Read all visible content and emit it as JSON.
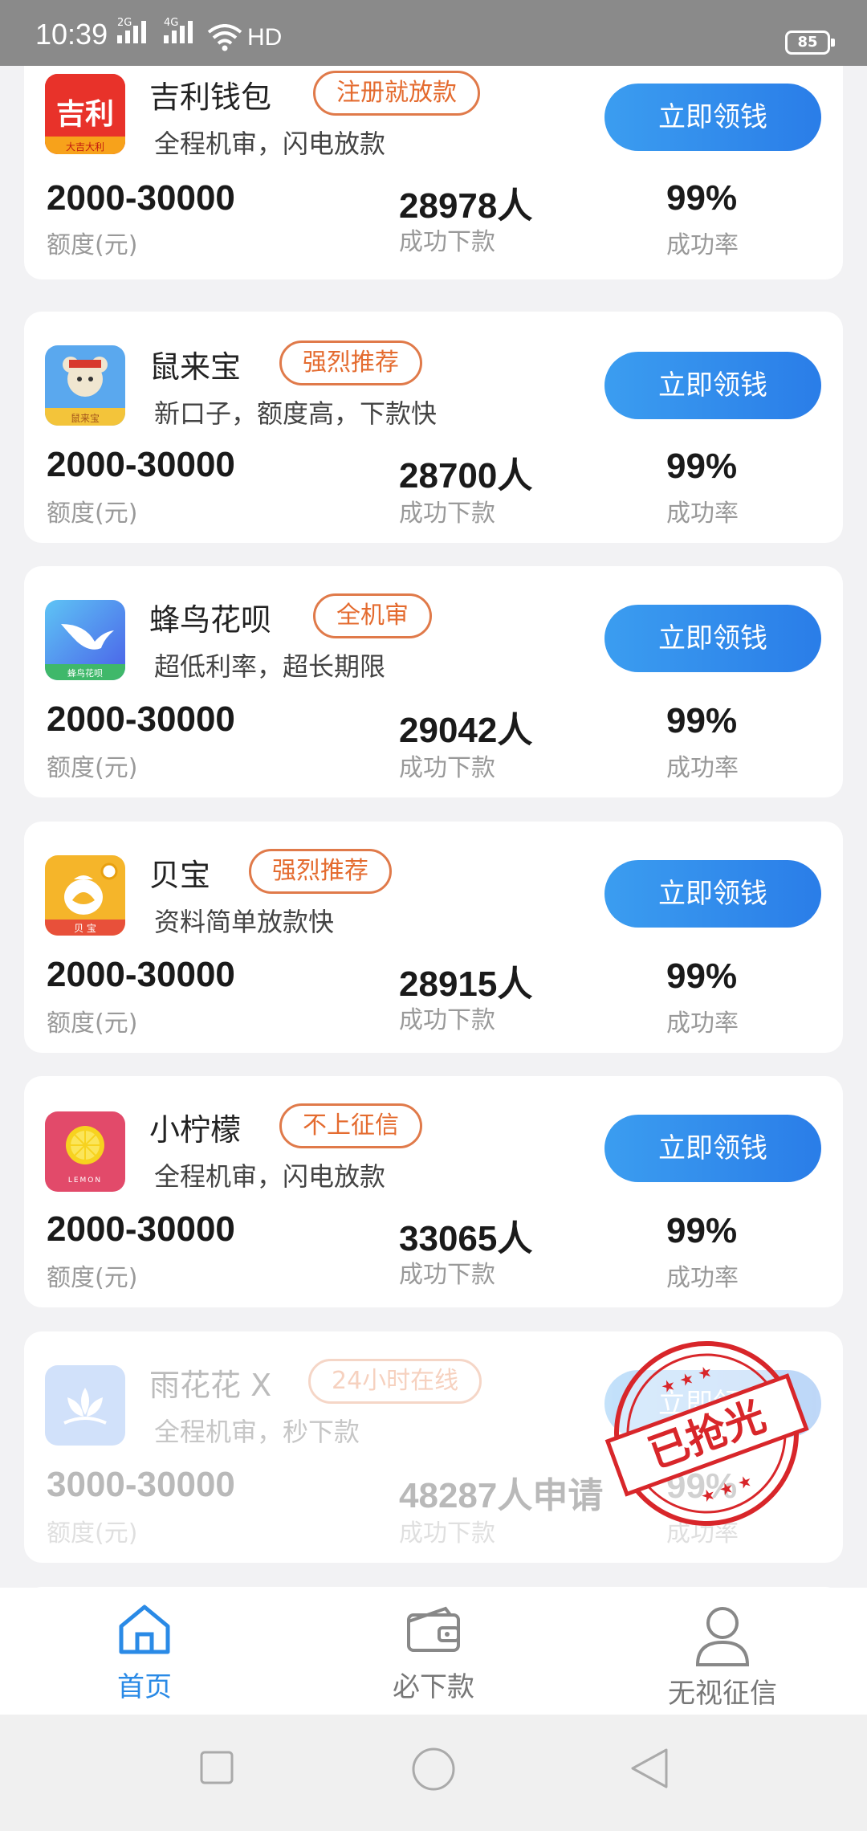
{
  "status_bar": {
    "time": "10:39",
    "sim1_label": "2G",
    "sim2_label": "4G",
    "network_label": "HD",
    "battery_level": "85"
  },
  "cards": [
    {
      "name": "吉利钱包",
      "tag": "注册就放款",
      "desc": "全程机审，闪电放款",
      "button": "立即领钱",
      "amount": "2000-30000",
      "amount_label": "额度(元)",
      "count": "28978人",
      "count_label": "成功下款",
      "rate": "99%",
      "rate_label": "成功率",
      "logo": {
        "icon": "jili-logo-icon",
        "text": "吉利",
        "caption": "大吉大利",
        "color": "#e8322a"
      }
    },
    {
      "name": "鼠来宝",
      "tag": "强烈推荐",
      "desc": "新口子，额度高，下款快",
      "button": "立即领钱",
      "amount": "2000-30000",
      "amount_label": "额度(元)",
      "count": "28700人",
      "count_label": "成功下款",
      "rate": "99%",
      "rate_label": "成功率",
      "logo": {
        "icon": "mouse-logo-icon",
        "caption": "鼠来宝",
        "color": "#3a8fe0"
      }
    },
    {
      "name": "蜂鸟花呗",
      "tag": "全机审",
      "desc": "超低利率，超长期限",
      "button": "立即领钱",
      "amount": "2000-30000",
      "amount_label": "额度(元)",
      "count": "29042人",
      "count_label": "成功下款",
      "rate": "99%",
      "rate_label": "成功率",
      "logo": {
        "icon": "hummingbird-logo-icon",
        "caption": "蜂鸟花呗",
        "color": "#4a8ef0"
      }
    },
    {
      "name": "贝宝",
      "tag": "强烈推荐",
      "desc": "资料简单放款快",
      "button": "立即领钱",
      "amount": "2000-30000",
      "amount_label": "额度(元)",
      "count": "28915人",
      "count_label": "成功下款",
      "rate": "99%",
      "rate_label": "成功率",
      "logo": {
        "icon": "money-bag-logo-icon",
        "caption": "贝 宝",
        "color": "#f5b52a"
      }
    },
    {
      "name": "小柠檬",
      "tag": "不上征信",
      "desc": "全程机审，闪电放款",
      "button": "立即领钱",
      "amount": "2000-30000",
      "amount_label": "额度(元)",
      "count": "33065人",
      "count_label": "成功下款",
      "rate": "99%",
      "rate_label": "成功率",
      "logo": {
        "icon": "lemon-logo-icon",
        "caption": "LEMON",
        "color": "#e24a6a"
      }
    },
    {
      "name": "雨花花 X",
      "tag": "24小时在线",
      "desc": "全程机审，秒下款",
      "button": "立即领钱",
      "amount": "3000-30000",
      "amount_label": "额度(元)",
      "count": "48287人申请",
      "count_label": "成功下款",
      "rate": "99%",
      "rate_label": "成功率",
      "logo": {
        "icon": "lotus-logo-icon",
        "color": "#6a9ef0"
      },
      "sold_out_stamp": "已抢光"
    }
  ],
  "tabbar": {
    "items": [
      {
        "label": "首页",
        "icon": "home-icon",
        "active": true
      },
      {
        "label": "必下款",
        "icon": "wallet-icon",
        "active": false
      },
      {
        "label": "无视征信",
        "icon": "user-icon",
        "active": false
      }
    ],
    "active_color": "#2a8ae6"
  },
  "system_nav": {
    "keys": [
      "recent-apps-icon",
      "home-circle-icon",
      "back-triangle-icon"
    ]
  }
}
